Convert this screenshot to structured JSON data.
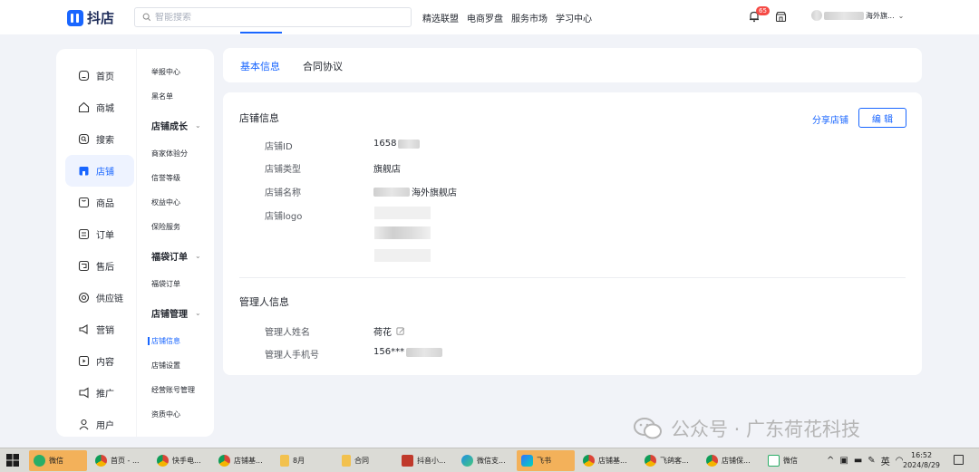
{
  "topbar": {
    "brand": "抖店",
    "search_placeholder": "智能搜索",
    "nav": [
      "精选联盟",
      "电商罗盘",
      "服务市场",
      "学习中心"
    ],
    "notification_count": "65",
    "user_name_suffix": "海外旗..."
  },
  "sidebar": {
    "primary": [
      {
        "label": "首页",
        "icon": "home-icon"
      },
      {
        "label": "商城",
        "icon": "mall-icon"
      },
      {
        "label": "搜索",
        "icon": "search-icon"
      },
      {
        "label": "店铺",
        "icon": "store-icon",
        "active": true
      },
      {
        "label": "商品",
        "icon": "product-icon"
      },
      {
        "label": "订单",
        "icon": "order-icon"
      },
      {
        "label": "售后",
        "icon": "after-sales-icon"
      },
      {
        "label": "供应链",
        "icon": "supply-chain-icon"
      },
      {
        "label": "营销",
        "icon": "marketing-icon"
      },
      {
        "label": "内容",
        "icon": "content-icon"
      },
      {
        "label": "推广",
        "icon": "promotion-icon"
      },
      {
        "label": "用户",
        "icon": "user-icon"
      }
    ],
    "secondary": {
      "item_1": "举报中心",
      "item_2": "黑名单",
      "group_1": "店铺成长",
      "item_3": "商家体验分",
      "item_4": "信誉等级",
      "item_5": "权益中心",
      "item_6": "保险服务",
      "group_2": "福袋订单",
      "item_7": "福袋订单",
      "group_3": "店铺管理",
      "item_8": "店铺信息",
      "item_9": "店铺设置",
      "item_10": "经营账号管理",
      "item_11": "资质中心"
    }
  },
  "tabs": {
    "basic_info": "基本信息",
    "contract": "合同协议"
  },
  "store_info": {
    "section_title": "店铺信息",
    "share_label": "分享店铺",
    "edit_label": "编 辑",
    "id_label": "店铺ID",
    "id_value": "1658",
    "type_label": "店铺类型",
    "type_value": "旗舰店",
    "name_label": "店铺名称",
    "name_value": "海外旗舰店",
    "logo_label": "店铺logo"
  },
  "manager_info": {
    "section_title": "管理人信息",
    "name_label": "管理人姓名",
    "name_value": "荷花",
    "phone_label": "管理人手机号",
    "phone_value": "156***"
  },
  "watermark": {
    "text": "公众号 · 广东荷花科技"
  },
  "taskbar": {
    "items": [
      "微信",
      "首页 - ...",
      "快手电...",
      "店铺基...",
      "8月",
      "合同",
      "抖音小...",
      "微信支...",
      "飞书",
      "店铺基...",
      "飞鸽客...",
      "店铺保...",
      "微信"
    ],
    "ime": "英",
    "time": "16:52",
    "date": "2024/8/29"
  }
}
